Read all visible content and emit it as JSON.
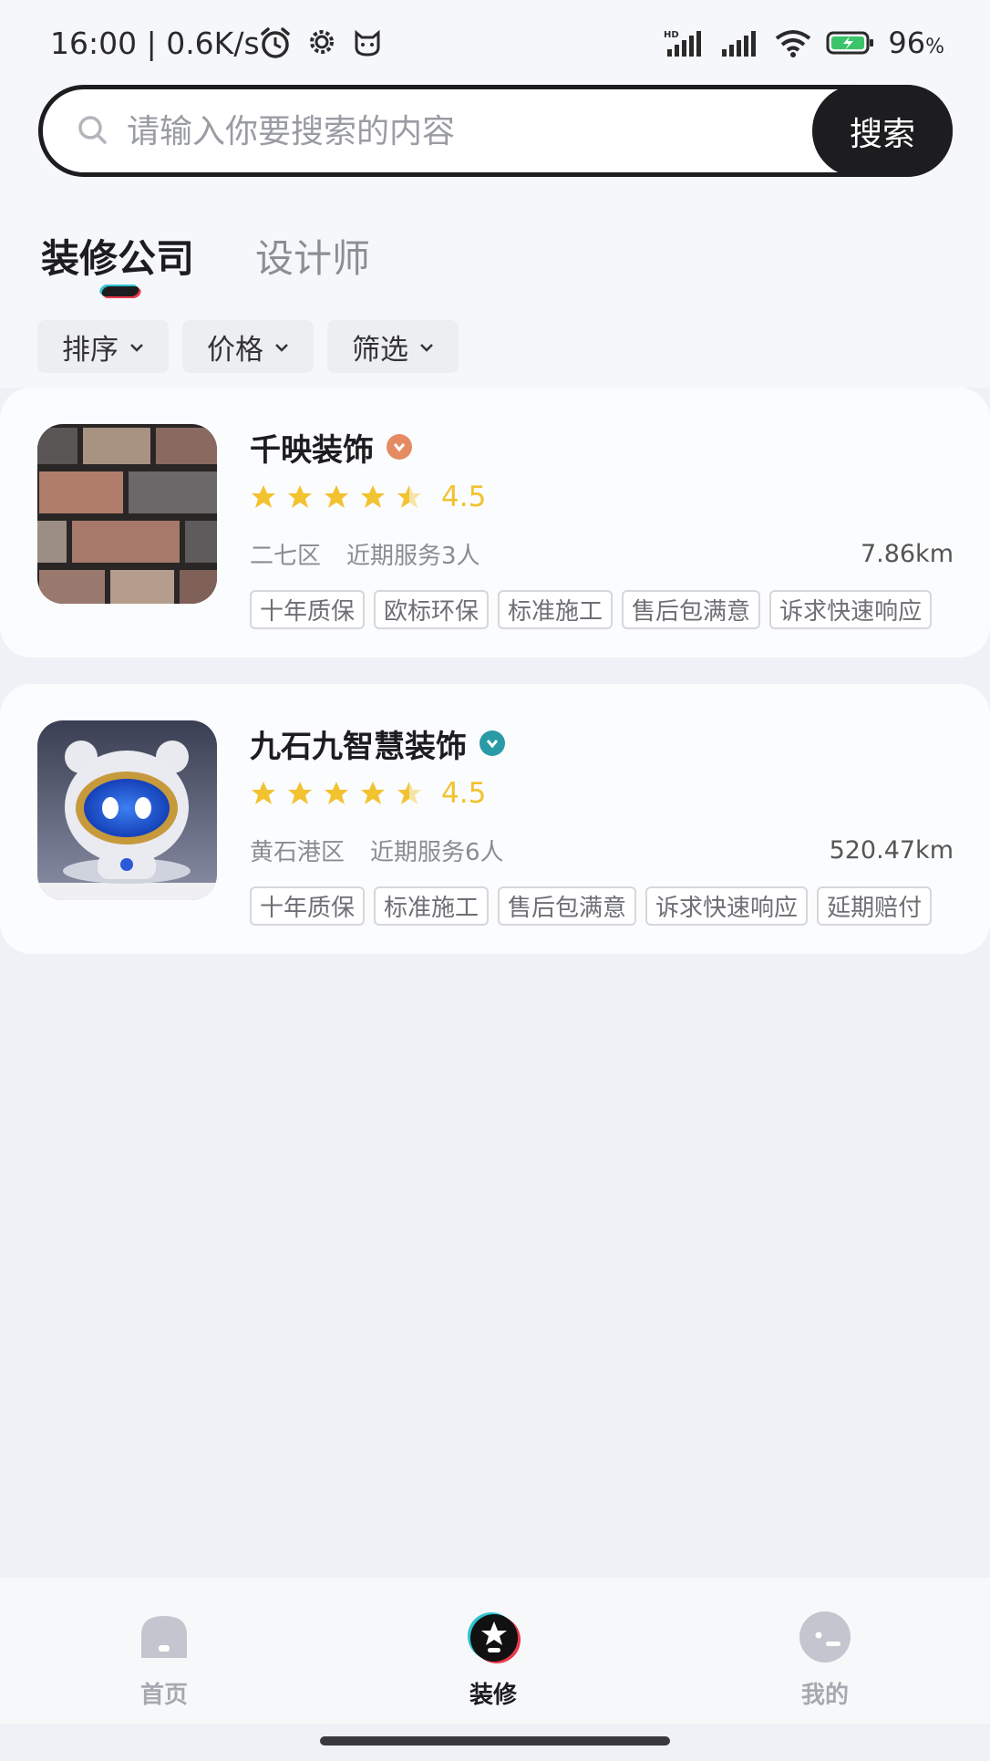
{
  "status_bar": {
    "time": "16:00 | 0.6K/s",
    "battery": "96",
    "battery_unit": "%",
    "icons": [
      "alarm-icon",
      "gear-icon",
      "cat-icon",
      "hd-signal-icon",
      "signal-icon",
      "wifi-icon",
      "battery-icon"
    ]
  },
  "search": {
    "placeholder": "请输入你要搜索的内容",
    "button_label": "搜索"
  },
  "tabs": [
    {
      "label": "装修公司",
      "active": true
    },
    {
      "label": "设计师",
      "active": false
    }
  ],
  "filters": [
    {
      "label": "排序"
    },
    {
      "label": "价格"
    },
    {
      "label": "筛选"
    }
  ],
  "companies": [
    {
      "name": "千映装饰",
      "badge_color": "#e48b64",
      "rating": "4.5",
      "stars": 4.5,
      "district": "二七区",
      "served": "近期服务3人",
      "distance": "7.86km",
      "tags": [
        "十年质保",
        "欧标环保",
        "标准施工",
        "售后包满意",
        "诉求快速响应"
      ]
    },
    {
      "name": "九石九智慧装饰",
      "badge_color": "#2a9aa6",
      "rating": "4.5",
      "stars": 4.5,
      "district": "黄石港区",
      "served": "近期服务6人",
      "distance": "520.47km",
      "tags": [
        "十年质保",
        "标准施工",
        "售后包满意",
        "诉求快速响应",
        "延期赔付"
      ]
    }
  ],
  "bottom_nav": [
    {
      "label": "首页",
      "icon": "home-icon",
      "active": false
    },
    {
      "label": "装修",
      "icon": "star-badge-icon",
      "active": true
    },
    {
      "label": "我的",
      "icon": "profile-icon",
      "active": false
    }
  ],
  "colors": {
    "accent": "#1d1d1f",
    "star": "#f2c230",
    "nav_inactive": "#a7a9b0"
  }
}
